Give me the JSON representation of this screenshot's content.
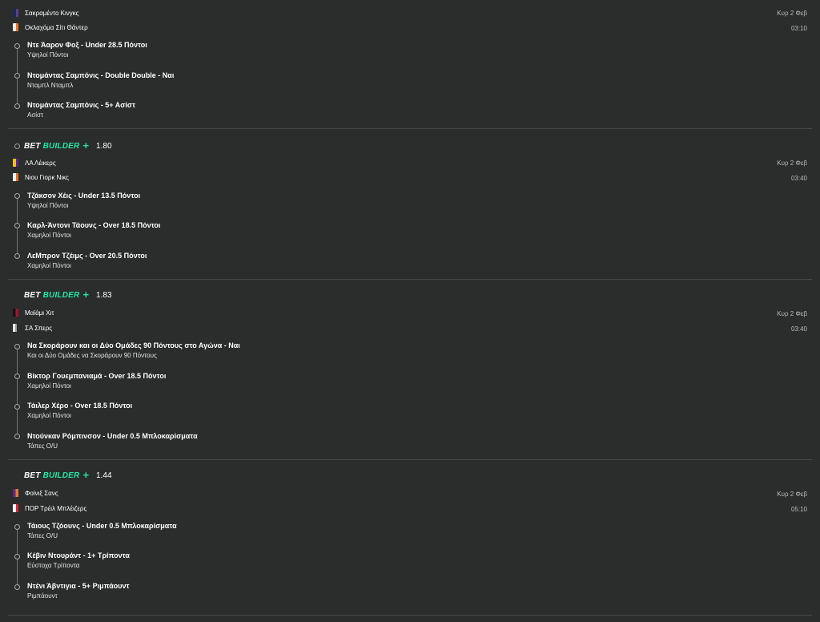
{
  "bets": [
    {
      "odds": "",
      "date": "Κυρ 2 Φεβ",
      "time": "03:10",
      "teams": [
        {
          "name": "Σακραμέντο Κινγκς",
          "colors": [
            "#1e2a55",
            "#5b3f8a"
          ]
        },
        {
          "name": "Οκλαχόμα Σίτι Θάντερ",
          "colors": [
            "#f0efe7",
            "#e8742a"
          ]
        }
      ],
      "legs": [
        {
          "title": "Ντε Άαρον Φοξ - Under 28.5 Πόντοι",
          "sub": "Υψηλοί Πόντοι"
        },
        {
          "title": "Ντομάντας Σαμπόνις - Double Double - Ναι",
          "sub": "Νταμπλ Νταμπλ"
        },
        {
          "title": "Ντομάντας Σαμπόνις - 5+ Ασίστ",
          "sub": "Ασίστ"
        }
      ]
    },
    {
      "odds": "1.80",
      "date": "Κυρ 2 Φεβ",
      "time": "03:40",
      "teams": [
        {
          "name": "ΛΑ Λέικερς",
          "colors": [
            "#f6c21b",
            "#56288a"
          ]
        },
        {
          "name": "Νιου Γιορκ Νικς",
          "colors": [
            "#f2f2f2",
            "#e86b28"
          ]
        }
      ],
      "legs": [
        {
          "title": "Τζάκσον Χέις - Under 13.5 Πόντοι",
          "sub": "Υψηλοί Πόντοι"
        },
        {
          "title": "Καρλ-Άντονι Τάουνς - Over 18.5 Πόντοι",
          "sub": "Χαμηλοί Πόντοι"
        },
        {
          "title": "ΛεΜπρον Τζέιμς - Over 20.5 Πόντοι",
          "sub": "Χαμηλοί Πόντοι"
        }
      ]
    },
    {
      "odds": "1.83",
      "date": "Κυρ 2 Φεβ",
      "time": "03:40",
      "teams": [
        {
          "name": "Μαϊάμι Χιτ",
          "colors": [
            "#141414",
            "#a3122c"
          ]
        },
        {
          "name": "ΣΑ Σπερς",
          "colors": [
            "#e8e8e8",
            "#9aa0a6"
          ]
        }
      ],
      "legs": [
        {
          "title": "Να Σκοράρουν και οι Δύο Ομάδες 90 Πόντους στο Αγώνα - Ναι",
          "sub": "Και οι Δύο Ομάδες να Σκοράρουν 90 Πόντους"
        },
        {
          "title": "Βίκτορ Γουεμπανιαμά - Over 18.5 Πόντοι",
          "sub": "Χαμηλοί Πόντοι"
        },
        {
          "title": "Τάιλερ Χέρο - Over 18.5 Πόντοι",
          "sub": "Χαμηλοί Πόντοι"
        },
        {
          "title": "Ντούνκαν Ρόμπινσον - Under 0.5 Μπλοκαρίσματα",
          "sub": "Τάπες O/U"
        }
      ]
    },
    {
      "odds": "1.44",
      "date": "Κυρ 2 Φεβ",
      "time": "05:10",
      "teams": [
        {
          "name": "Φοίνιξ Σανς",
          "colors": [
            "#5a2a86",
            "#e57a32"
          ]
        },
        {
          "name": "ΠΟΡ Τρέιλ Μπλέιζερς",
          "colors": [
            "#f2f2f2",
            "#d3263a"
          ]
        }
      ],
      "legs": [
        {
          "title": "Τάιους Τζόουνς - Under 0.5 Μπλοκαρίσματα",
          "sub": "Τάπες O/U"
        },
        {
          "title": "Κέβιν Ντουράντ - 1+ Τρίποντα",
          "sub": "Εύστοχα Τρίποντα"
        },
        {
          "title": "Ντένι Άβντιγια - 5+ Ριμπάουντ",
          "sub": "Ριμπάουντ"
        }
      ]
    }
  ],
  "builder": {
    "word1": "BET",
    "word2": "BUILDER",
    "plus": "+"
  },
  "colors": {
    "background": "#2b2d2c",
    "accent": "#21e6a3",
    "divider": "#454846"
  }
}
